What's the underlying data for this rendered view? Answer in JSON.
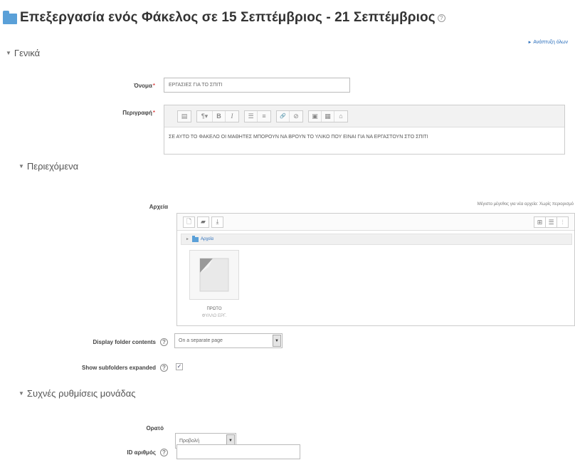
{
  "page": {
    "title": "Επεξεργασία ενός Φάκελος σε 15 Σεπτέμβριος - 21 Σεπτέμβριος",
    "help_symbol": "?",
    "expand_all": "Ανάπτυξη όλων"
  },
  "sections": {
    "general": "Γενικά",
    "contents": "Περιεχόμενα",
    "common": "Συχνές ρυθμίσεις μονάδας"
  },
  "general": {
    "name_label": "Όνομα",
    "name_value": "ΕΡΓΑΣΙΕΣ ΓΙΑ ΤΟ ΣΠΙΤΙ",
    "description_label": "Περιγραφή",
    "required_mark": "*",
    "description_text": "ΣΕ ΑΥΤΟ ΤΟ ΦΑΚΕΛΟ ΟΙ ΜΑΘΗΤΕΣ ΜΠΟΡΟΥΝ ΝΑ ΒΡΟΥΝ ΤΟ ΥΛΙΚΟ ΠΟΥ ΕΙΝΑΙ ΓΙΑ ΝΑ ΕΡΓΑΣΤΟΥΝ ΣΤΟ ΣΠΙΤΙ",
    "editor_buttons": [
      {
        "icon": "toolbar-toggle-icon",
        "glyph": "▤"
      },
      {
        "icon": "paragraph-style-icon",
        "glyph": "¶▾"
      },
      {
        "icon": "bold-icon",
        "glyph": "B"
      },
      {
        "icon": "italic-icon",
        "glyph": "I"
      },
      {
        "icon": "unordered-list-icon",
        "glyph": "☰"
      },
      {
        "icon": "ordered-list-icon",
        "glyph": "≡"
      },
      {
        "icon": "link-icon",
        "glyph": "🔗"
      },
      {
        "icon": "unlink-icon",
        "glyph": "⊘"
      },
      {
        "icon": "image-icon",
        "glyph": "▣"
      },
      {
        "icon": "media-icon",
        "glyph": "▦"
      },
      {
        "icon": "manage-files-icon",
        "glyph": "⌂"
      }
    ]
  },
  "contents": {
    "files_label": "Αρχεία",
    "max_size_note": "Μέγιστο μέγεθος για νέα αρχεία: Χωρίς περιορισμό",
    "path_root": "Αρχεία",
    "file_name": "ΠΡΩΤΟ",
    "file_name_2": "ΦΥΛΛΟ ΕΡΓ.",
    "display_label": "Display folder contents",
    "display_value": "On a separate page",
    "subfolders_label": "Show subfolders expanded",
    "subfolders_checked": "✓"
  },
  "common": {
    "visible_label": "Ορατό",
    "visible_value": "Προβολή",
    "id_label": "ID αριθμός",
    "id_value": ""
  },
  "colors": {
    "accent": "#2a6ebb",
    "folder": "#5aa0d8",
    "required": "#cc0000"
  }
}
